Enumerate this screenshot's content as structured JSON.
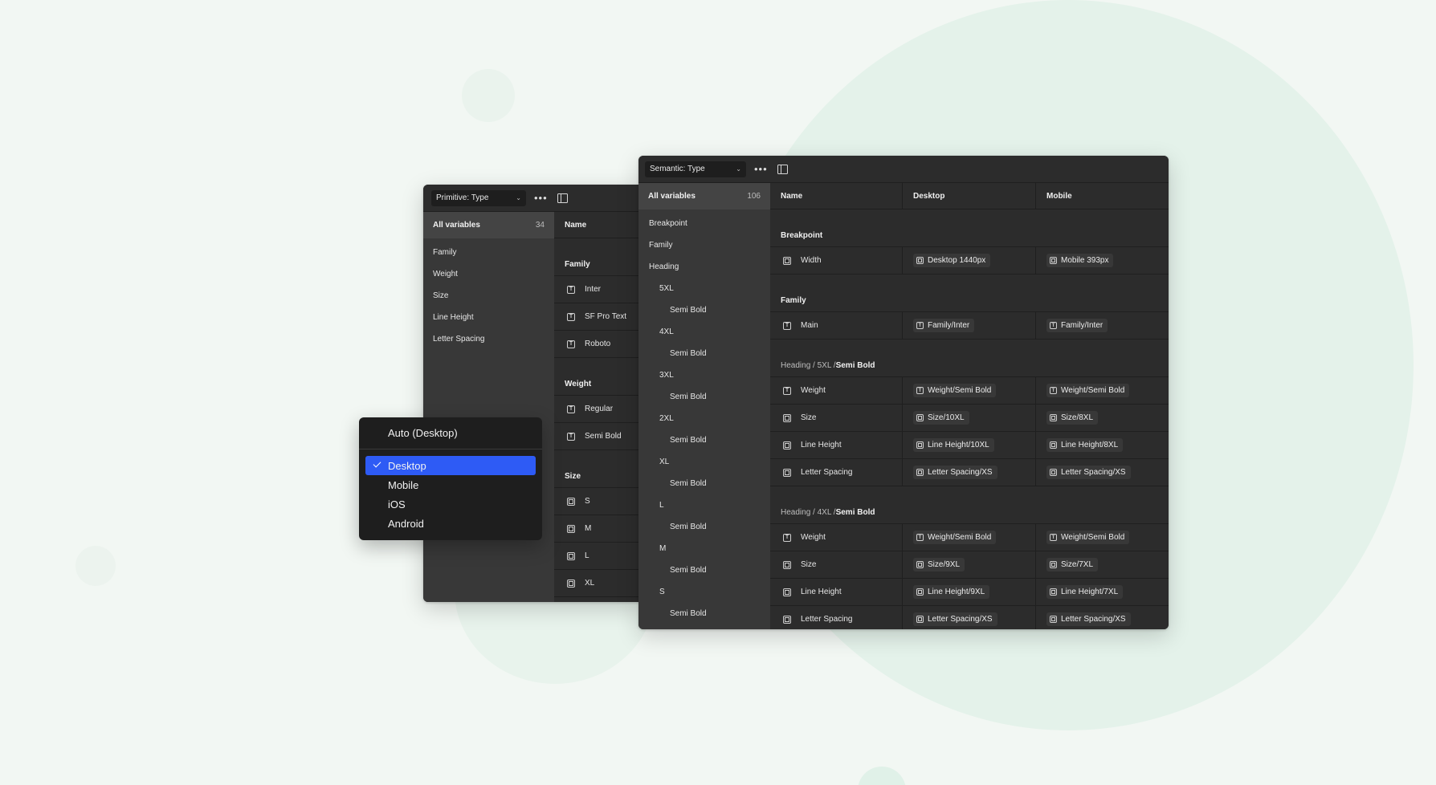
{
  "primitive": {
    "collection": "Primitive: Type",
    "sidebar": {
      "all_label": "All variables",
      "all_count": "34",
      "items": [
        "Family",
        "Weight",
        "Size",
        "Line Height",
        "Letter Spacing"
      ]
    },
    "col_name": "Name",
    "groups": [
      {
        "title": "Family",
        "rows": [
          {
            "icon": "string",
            "name": "Inter"
          },
          {
            "icon": "string",
            "name": "SF Pro Text"
          },
          {
            "icon": "string",
            "name": "Roboto"
          }
        ]
      },
      {
        "title": "Weight",
        "rows": [
          {
            "icon": "string",
            "name": "Regular"
          },
          {
            "icon": "string",
            "name": "Semi Bold"
          }
        ]
      },
      {
        "title": "Size",
        "rows": [
          {
            "icon": "number",
            "name": "S"
          },
          {
            "icon": "number",
            "name": "M"
          },
          {
            "icon": "number",
            "name": "L"
          },
          {
            "icon": "number",
            "name": "XL"
          }
        ]
      }
    ]
  },
  "semantic": {
    "collection": "Semantic: Type",
    "sidebar": {
      "all_label": "All variables",
      "all_count": "106",
      "items": [
        {
          "label": "Breakpoint",
          "level": 0
        },
        {
          "label": "Family",
          "level": 0
        },
        {
          "label": "Heading",
          "level": 0
        },
        {
          "label": "5XL",
          "level": 1
        },
        {
          "label": "Semi Bold",
          "level": 2
        },
        {
          "label": "4XL",
          "level": 1
        },
        {
          "label": "Semi Bold",
          "level": 2
        },
        {
          "label": "3XL",
          "level": 1
        },
        {
          "label": "Semi Bold",
          "level": 2
        },
        {
          "label": "2XL",
          "level": 1
        },
        {
          "label": "Semi Bold",
          "level": 2
        },
        {
          "label": "XL",
          "level": 1
        },
        {
          "label": "Semi Bold",
          "level": 2
        },
        {
          "label": "L",
          "level": 1
        },
        {
          "label": "Semi Bold",
          "level": 2
        },
        {
          "label": "M",
          "level": 1
        },
        {
          "label": "Semi Bold",
          "level": 2
        },
        {
          "label": "S",
          "level": 1
        },
        {
          "label": "Semi Bold",
          "level": 2
        }
      ]
    },
    "columns": [
      "Name",
      "Desktop",
      "Mobile"
    ],
    "groups": [
      {
        "title": "Breakpoint",
        "title_path": "",
        "rows": [
          {
            "icon": "number",
            "name": "Width",
            "desktop": "Desktop 1440px",
            "desktop_icon": "number",
            "mobile": "Mobile 393px",
            "mobile_icon": "number"
          }
        ]
      },
      {
        "title": "Family",
        "title_path": "",
        "rows": [
          {
            "icon": "string",
            "name": "Main",
            "desktop": "Family/Inter",
            "desktop_icon": "string",
            "mobile": "Family/Inter",
            "mobile_icon": "string"
          }
        ]
      },
      {
        "title": "Semi Bold",
        "title_path": "Heading / 5XL / ",
        "rows": [
          {
            "icon": "string",
            "name": "Weight",
            "desktop": "Weight/Semi Bold",
            "desktop_icon": "string",
            "mobile": "Weight/Semi Bold",
            "mobile_icon": "string"
          },
          {
            "icon": "number",
            "name": "Size",
            "desktop": "Size/10XL",
            "desktop_icon": "number",
            "mobile": "Size/8XL",
            "mobile_icon": "number"
          },
          {
            "icon": "number",
            "name": "Line Height",
            "desktop": "Line Height/10XL",
            "desktop_icon": "number",
            "mobile": "Line Height/8XL",
            "mobile_icon": "number"
          },
          {
            "icon": "number",
            "name": "Letter Spacing",
            "desktop": "Letter Spacing/XS",
            "desktop_icon": "number",
            "mobile": "Letter Spacing/XS",
            "mobile_icon": "number"
          }
        ]
      },
      {
        "title": "Semi Bold",
        "title_path": "Heading / 4XL / ",
        "rows": [
          {
            "icon": "string",
            "name": "Weight",
            "desktop": "Weight/Semi Bold",
            "desktop_icon": "string",
            "mobile": "Weight/Semi Bold",
            "mobile_icon": "string"
          },
          {
            "icon": "number",
            "name": "Size",
            "desktop": "Size/9XL",
            "desktop_icon": "number",
            "mobile": "Size/7XL",
            "mobile_icon": "number"
          },
          {
            "icon": "number",
            "name": "Line Height",
            "desktop": "Line Height/9XL",
            "desktop_icon": "number",
            "mobile": "Line Height/7XL",
            "mobile_icon": "number"
          },
          {
            "icon": "number",
            "name": "Letter Spacing",
            "desktop": "Letter Spacing/XS",
            "desktop_icon": "number",
            "mobile": "Letter Spacing/XS",
            "mobile_icon": "number"
          }
        ]
      }
    ]
  },
  "mode_menu": {
    "auto_label": "Auto (Desktop)",
    "options": [
      {
        "label": "Desktop",
        "selected": true
      },
      {
        "label": "Mobile",
        "selected": false
      },
      {
        "label": "iOS",
        "selected": false
      },
      {
        "label": "Android",
        "selected": false
      }
    ]
  },
  "colors": {
    "accent": "#2e5bf5",
    "panel_bg": "#2c2c2c",
    "sidebar_bg": "#383838",
    "page_bg": "#f2f7f3"
  }
}
